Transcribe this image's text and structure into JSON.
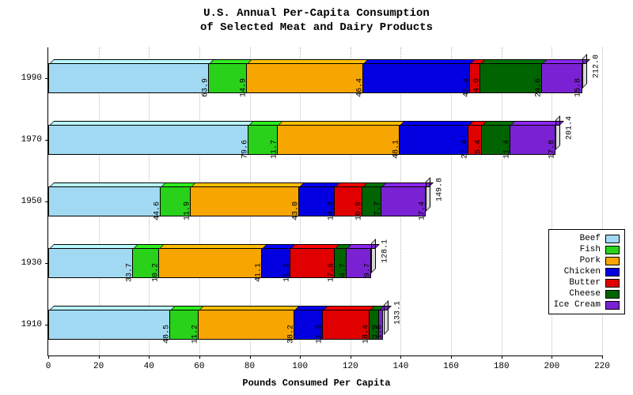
{
  "chart_data": {
    "type": "bar",
    "orientation": "horizontal",
    "stacked": true,
    "title": "U.S. Annual Per-Capita Consumption\nof Selected Meat and Dairy Products",
    "xlabel": "Pounds Consumed Per Capita",
    "ylabel": "",
    "xlim": [
      0,
      220
    ],
    "x_ticks": [
      0,
      20,
      40,
      60,
      80,
      100,
      120,
      140,
      160,
      180,
      200,
      220
    ],
    "categories": [
      "1990",
      "1970",
      "1950",
      "1930",
      "1910"
    ],
    "series": [
      {
        "name": "Beef",
        "color": "#a1d9f2",
        "values": [
          63.9,
          79.6,
          44.6,
          33.7,
          48.5
        ]
      },
      {
        "name": "Fish",
        "color": "#29d11a",
        "values": [
          14.9,
          11.7,
          11.9,
          10.2,
          11.2
        ]
      },
      {
        "name": "Pork",
        "color": "#f7a500",
        "values": [
          46.4,
          48.1,
          43.0,
          41.1,
          38.2
        ]
      },
      {
        "name": "Chicken",
        "color": "#0200e0",
        "values": [
          42.4,
          27.4,
          14.3,
          11.1,
          11.3
        ]
      },
      {
        "name": "Butter",
        "color": "#e00000",
        "values": [
          4.0,
          5.4,
          10.9,
          17.6,
          18.4
        ]
      },
      {
        "name": "Cheese",
        "color": "#006400",
        "values": [
          24.6,
          11.4,
          7.7,
          4.7,
          3.9
        ]
      },
      {
        "name": "Ice Cream",
        "color": "#7a22d3",
        "values": [
          15.8,
          17.8,
          17.4,
          9.7,
          1.6
        ]
      }
    ],
    "totals": [
      212.0,
      201.4,
      149.8,
      128.1,
      133.1
    ]
  }
}
